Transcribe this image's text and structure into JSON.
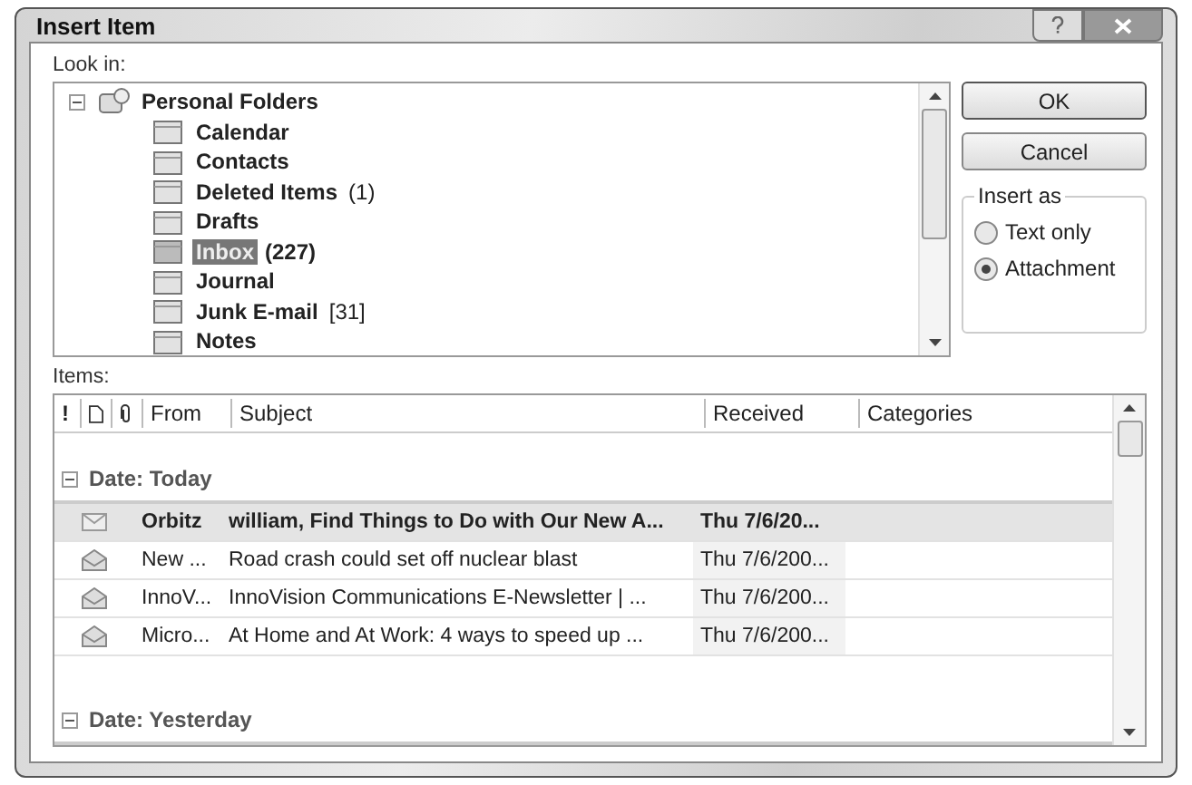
{
  "window": {
    "title": "Insert Item"
  },
  "look_in": {
    "label": "Look in:"
  },
  "folders": {
    "root": {
      "name": "Personal Folders",
      "expanded": true
    },
    "items": [
      {
        "name": "Calendar",
        "selected": false
      },
      {
        "name": "Contacts",
        "selected": false
      },
      {
        "name": "Deleted Items",
        "count": "(1)",
        "selected": false
      },
      {
        "name": "Drafts",
        "selected": false
      },
      {
        "name": "Inbox",
        "count": "(227)",
        "selected": true
      },
      {
        "name": "Journal",
        "selected": false
      },
      {
        "name": "Junk E-mail",
        "count": "[31]",
        "selected": false
      },
      {
        "name": "Notes",
        "selected": false
      }
    ]
  },
  "buttons": [
    "OK",
    "Cancel"
  ],
  "insert_as": {
    "label": "Insert as",
    "options": [
      {
        "label": "Text only",
        "selected": false
      },
      {
        "label": "Attachment",
        "selected": true
      }
    ]
  },
  "items": {
    "label": "Items:",
    "columns": [
      "!",
      "From",
      "Subject",
      "Received",
      "Categories"
    ],
    "groups": [
      {
        "label": "Date: Today",
        "expanded": true,
        "rows": [
          {
            "from": "Orbitz",
            "subject": "william, Find Things to Do with Our New A...",
            "received": "Thu 7/6/20...",
            "unread": true,
            "selected": true
          },
          {
            "from": "New ...",
            "subject": "Road crash could set off nuclear blast",
            "received": "Thu 7/6/200...",
            "unread": false,
            "selected": false
          },
          {
            "from": "InnoV...",
            "subject": "InnoVision Communications E-Newsletter | ...",
            "received": "Thu 7/6/200...",
            "unread": false,
            "selected": false
          },
          {
            "from": "Micro...",
            "subject": "At Home and At Work: 4 ways to speed up ...",
            "received": "Thu 7/6/200...",
            "unread": false,
            "selected": false
          }
        ]
      },
      {
        "label": "Date: Yesterday",
        "expanded": true
      }
    ]
  }
}
